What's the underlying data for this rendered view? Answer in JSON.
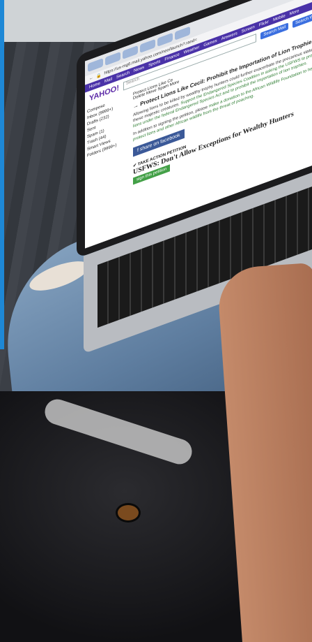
{
  "browser": {
    "url": "https://us-mg6.mail.yahoo.com/neo/launch?.rand=",
    "nav_items": [
      "Home",
      "Mail",
      "Search",
      "News",
      "Sports",
      "Finance",
      "Weather",
      "Games",
      "Answers",
      "Screen",
      "Flickr",
      "Mobile",
      "More"
    ],
    "search_placeholder": "Search",
    "search_mail_label": "Search Mail",
    "search_web_label": "Search Web"
  },
  "mail": {
    "logo": "YAHOO!",
    "compose_label": "Compose",
    "tab_label": "Protect Lions Like Ce",
    "toolbar": [
      "Delete",
      "Move",
      "Spam",
      "More"
    ],
    "folders": [
      "Inbox (9999+)",
      "Drafts (232)",
      "Sent",
      "Spam (1)",
      "Trash (44)",
      "Smart Views",
      "Folders (9999+)"
    ],
    "subject": "→ Protect Lions Like Cecil: Prohibit the Importation of Lion Trophies",
    "body_paragraph_1": "Allowing lions to be killed by wealthy trophy hunters could further exacerbate the precarious status of these majestic creatures.",
    "body_link_1": "Support the Endangered Species Coalition in asking the USFWS to protect lions under the federal Endangered Species Act and to prohibit the importation of lion trophies.",
    "body_paragraph_2": "In addition to signing the petition, please",
    "body_link_2": "make a donation to the African Wildlife Foundation to help protect lions and other African wildlife from the threat of poaching.",
    "share_button": "share on facebook",
    "take_action_label": "TAKE ACTION",
    "petition_label": "PETITION",
    "petition_headline": "USFWS: Don't Allow Exceptions for Wealthy Hunters",
    "sign_button": "sign this petition"
  },
  "colors": {
    "accent_bar": "#1e88d6",
    "yahoo_purple": "#4a32a8",
    "facebook_blue": "#3b5998",
    "petition_green": "#43a047"
  }
}
